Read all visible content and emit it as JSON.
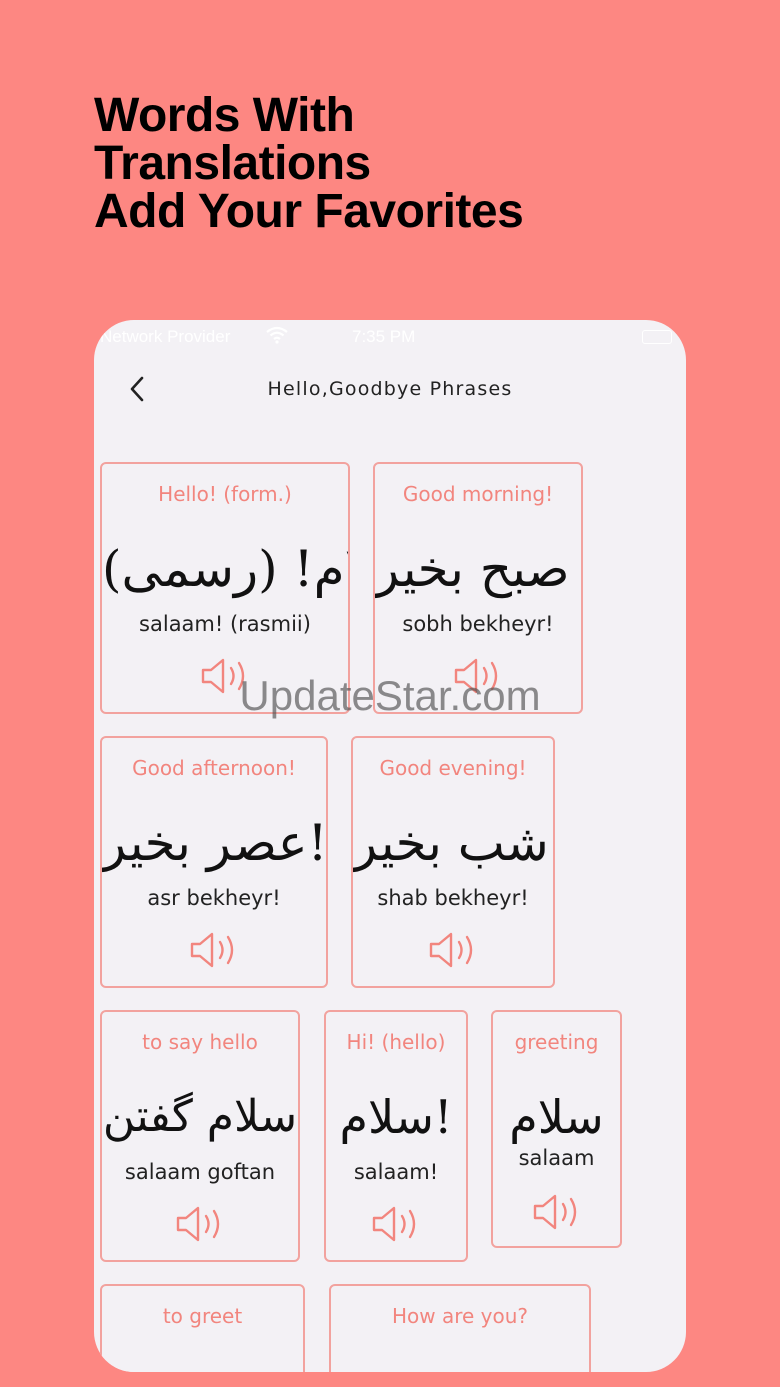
{
  "headline": {
    "line1": "Words With",
    "line2": "Translations",
    "line3": "Add Your Favorites"
  },
  "statusbar": {
    "carrier": "Network Provider",
    "time": "7:35 PM"
  },
  "nav": {
    "title": "Hello,Goodbye Phrases"
  },
  "cards": [
    {
      "en": "Hello! (form.)",
      "fa": "سلام! (رسمی)",
      "tr": "salaam! (rasmii)"
    },
    {
      "en": "Good morning!",
      "fa": "صبح بخیر !",
      "tr": "sobh bekheyr!"
    },
    {
      "en": "Good afternoon!",
      "fa": "عصر بخیر!",
      "tr": "asr bekheyr!"
    },
    {
      "en": "Good evening!",
      "fa": "شب بخیر!",
      "tr": "shab bekheyr!"
    },
    {
      "en": "to say hello",
      "fa": "سلام گفتن",
      "tr": "salaam goftan"
    },
    {
      "en": "Hi! (hello)",
      "fa": "سلام!",
      "tr": "salaam!"
    },
    {
      "en": "greeting",
      "fa": "سلام",
      "tr": "salaam"
    },
    {
      "en": "to greet",
      "fa": "",
      "tr": ""
    },
    {
      "en": "How are you?",
      "fa": "",
      "tr": ""
    }
  ],
  "icons": {
    "back": "chevron-left-icon",
    "speaker": "speaker-icon",
    "wifi": "wifi-icon",
    "battery": "battery-icon"
  },
  "colors": {
    "background": "#FD8782",
    "accent": "#F2857E",
    "card_border": "#F2A29E",
    "screen": "#F3F1F5"
  },
  "watermark": "UpdateStar.com"
}
